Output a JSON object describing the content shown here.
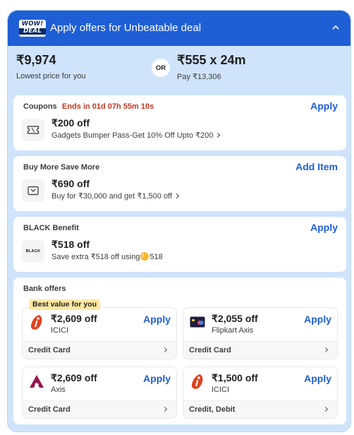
{
  "header": {
    "badge_line1": "WOW!",
    "badge_line2": "DEAL",
    "title": "Apply offers for Unbeatable deal",
    "accent": "#1f5fd6"
  },
  "pricing": {
    "lowest_price": "₹9,974",
    "lowest_label": "Lowest price for you",
    "or_label": "OR",
    "emi_price": "₹555 x 24m",
    "emi_total": "Pay ₹13,306"
  },
  "coupons": {
    "title": "Coupons",
    "timer": "Ends in 01d 07h 55m 10s",
    "action": "Apply",
    "amount": "₹200 off",
    "desc": "Gadgets Bumper Pass-Get 10% Off Upto ₹200",
    "icon": "ticket-icon"
  },
  "buy_more": {
    "title": "Buy More Save More",
    "action": "Add Item",
    "amount": "₹690 off",
    "desc": "Buy for ₹30,000 and get ₹1,500 off",
    "icon": "bag-icon"
  },
  "black": {
    "title": "BLACK Benefit",
    "action": "Apply",
    "logo_text": "BLACK",
    "amount": "₹518 off",
    "desc_prefix": "Save extra ₹518 off using",
    "coins": "518"
  },
  "bank": {
    "title": "Bank offers",
    "best_tag": "Best value for you",
    "offers": [
      {
        "amount": "₹2,609 off",
        "bank": "ICICI",
        "apply": "Apply",
        "type": "Credit Card",
        "logo": "icici-logo-icon"
      },
      {
        "amount": "₹2,055 off",
        "bank": "Flipkart Axis",
        "apply": "Apply",
        "type": "Credit Card",
        "logo": "flipkart-axis-card-icon"
      },
      {
        "amount": "₹2,609 off",
        "bank": "Axis",
        "apply": "Apply",
        "type": "Credit Card",
        "logo": "axis-logo-icon"
      },
      {
        "amount": "₹1,500 off",
        "bank": "ICICI",
        "apply": "Apply",
        "type": "Credit, Debit",
        "logo": "icici-logo-icon"
      }
    ]
  }
}
